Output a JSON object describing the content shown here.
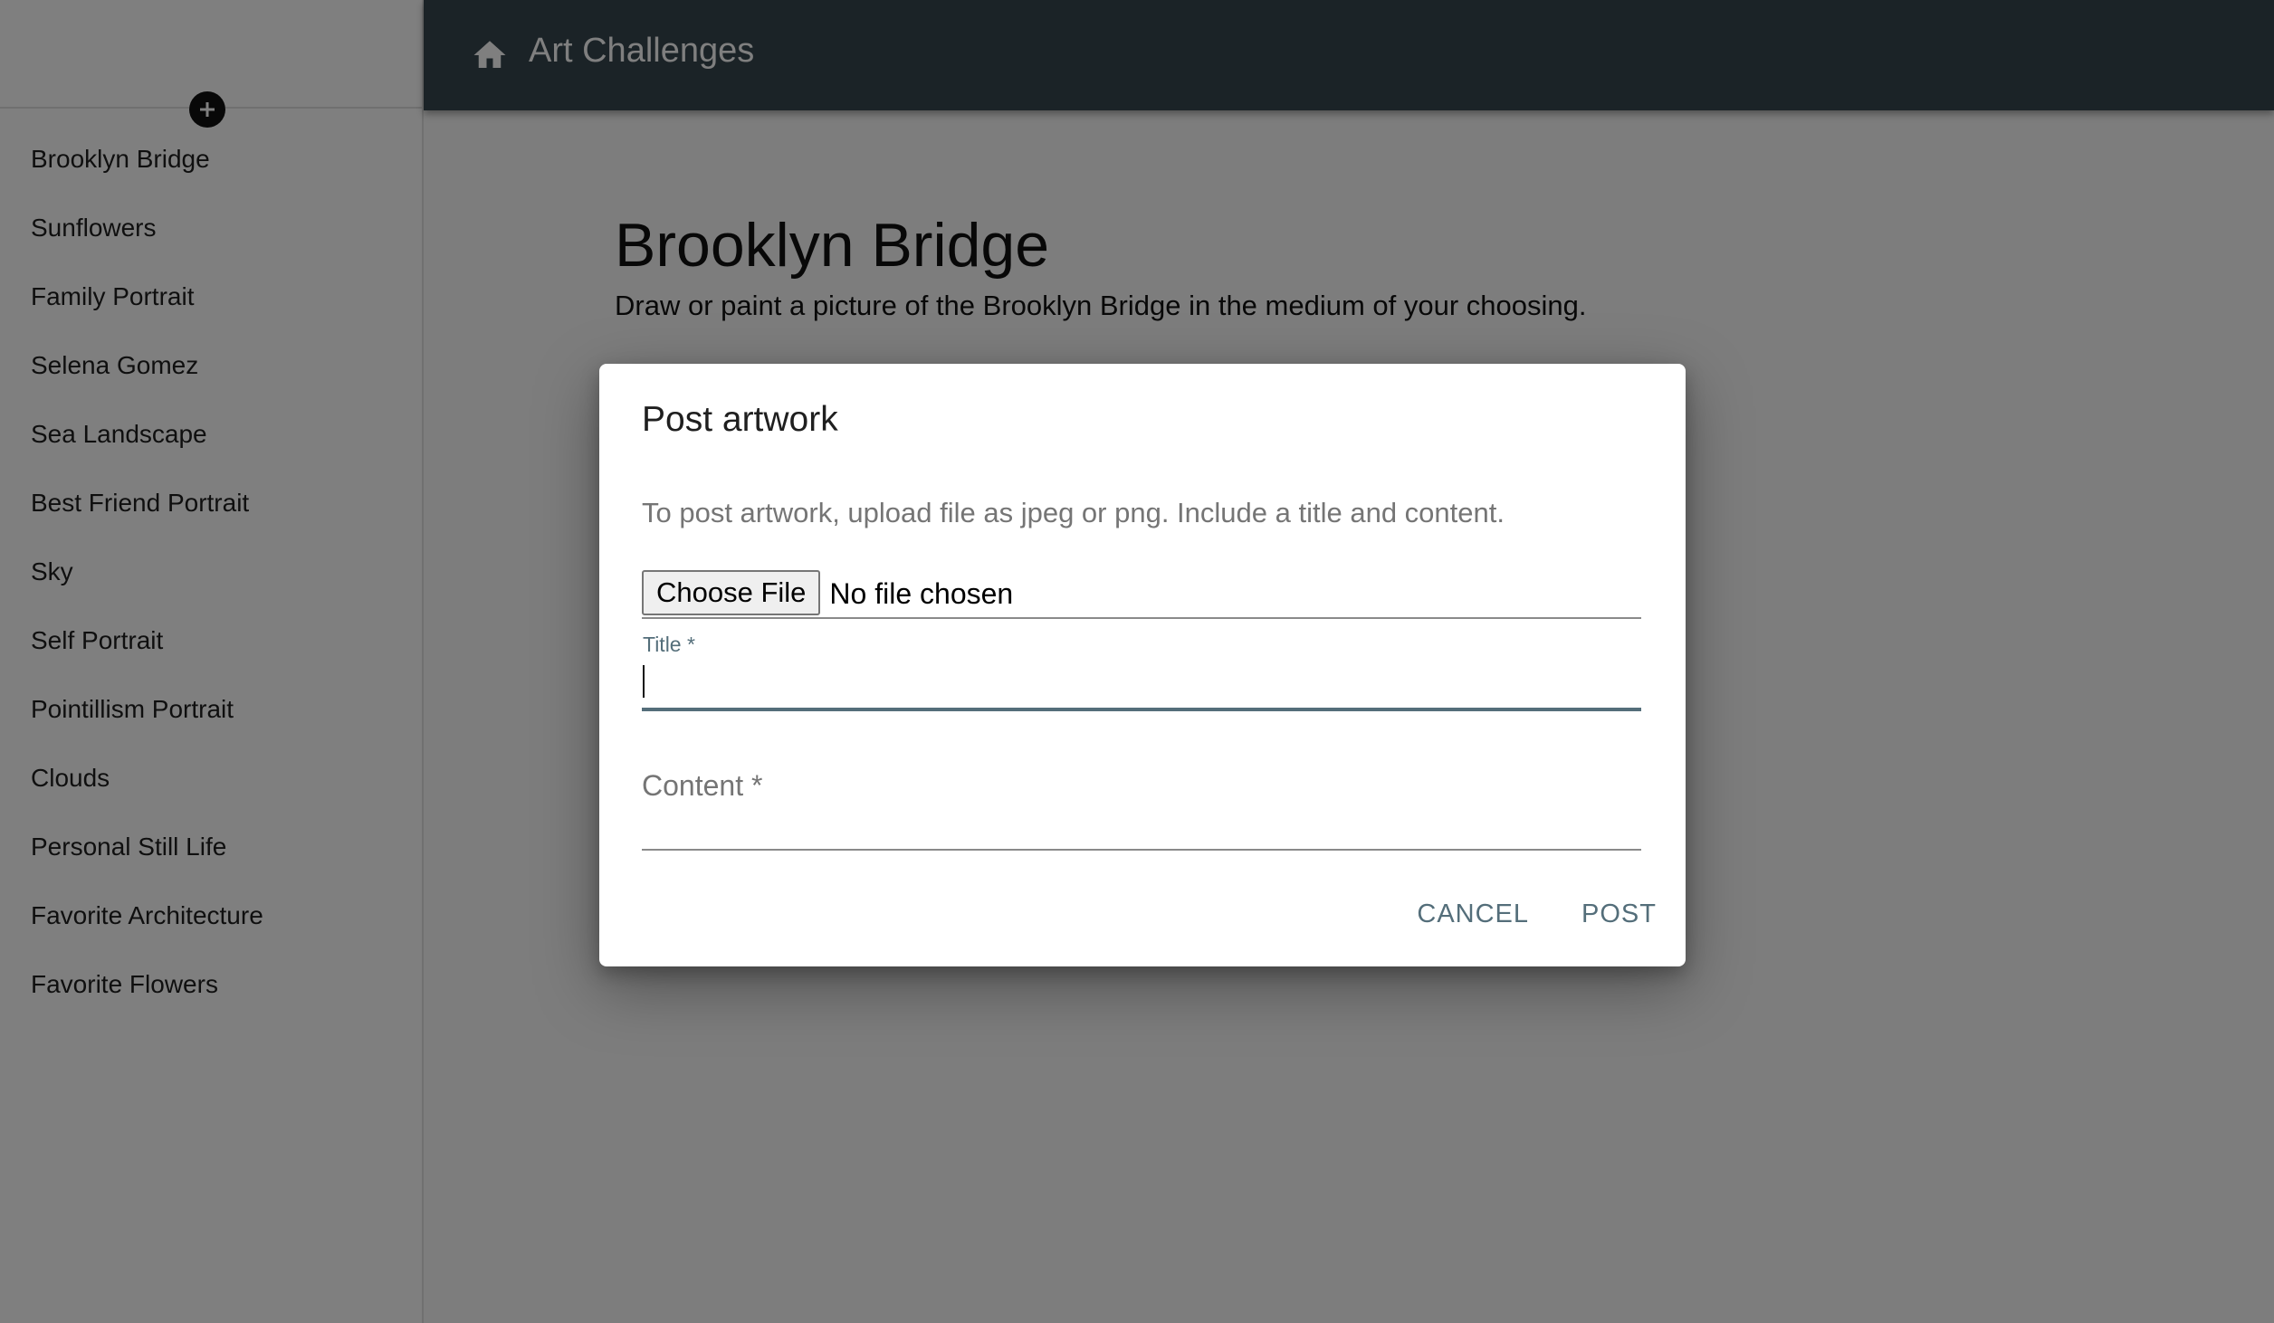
{
  "topbar": {
    "title": "Art Challenges",
    "home_icon": "home-icon",
    "bg_color": "#37474f"
  },
  "sidebar": {
    "add_icon": "plus-circle-icon",
    "items": [
      {
        "label": "Brooklyn Bridge"
      },
      {
        "label": "Sunflowers"
      },
      {
        "label": "Family Portrait"
      },
      {
        "label": "Selena Gomez"
      },
      {
        "label": "Sea Landscape"
      },
      {
        "label": "Best Friend Portrait"
      },
      {
        "label": "Sky"
      },
      {
        "label": "Self Portrait"
      },
      {
        "label": "Pointillism Portrait"
      },
      {
        "label": "Clouds"
      },
      {
        "label": "Personal Still Life"
      },
      {
        "label": "Favorite Architecture"
      },
      {
        "label": "Favorite Flowers"
      }
    ]
  },
  "main": {
    "challenge_title": "Brooklyn Bridge",
    "challenge_description": "Draw or paint a picture of the Brooklyn Bridge in the medium of your choosing."
  },
  "dialog": {
    "title": "Post artwork",
    "instructions": "To post artwork, upload file as jpeg or png. Include a title and content.",
    "file_button_label": "Choose File",
    "file_status": "No file chosen",
    "title_label": "Title *",
    "title_value": "",
    "content_label": "Content *",
    "content_value": "",
    "cancel_label": "CANCEL",
    "post_label": "POST",
    "accent_color": "#546e7a"
  }
}
